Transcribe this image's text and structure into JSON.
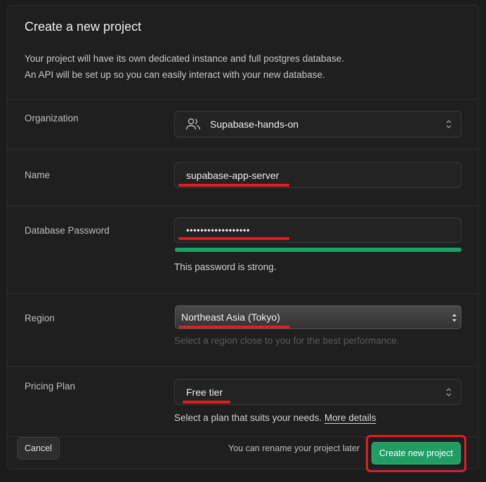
{
  "header": {
    "title": "Create a new project",
    "description_line1": "Your project will have its own dedicated instance and full postgres database.",
    "description_line2": "An API will be set up so you can easily interact with your new database."
  },
  "organization": {
    "label": "Organization",
    "value": "Supabase-hands-on",
    "icon": "users-icon"
  },
  "name": {
    "label": "Name",
    "value": "supabase-app-server"
  },
  "password": {
    "label": "Database Password",
    "value": "••••••••••••••••••",
    "strength_message": "This password is strong.",
    "strength_fraction": 1.0,
    "strength_color": "#1aa16a"
  },
  "region": {
    "label": "Region",
    "value": "Northeast Asia (Tokyo)",
    "hint": "Select a region close to you for the best performance."
  },
  "pricing": {
    "label": "Pricing Plan",
    "value": "Free tier",
    "hint": "Select a plan that suits your needs.",
    "more_link": "More details"
  },
  "footer": {
    "cancel_label": "Cancel",
    "note": "You can rename your project later",
    "create_label": "Create new project"
  },
  "colors": {
    "accent": "#1f9d63",
    "annotation_red": "#e11d23",
    "background": "#1f1f1f"
  }
}
